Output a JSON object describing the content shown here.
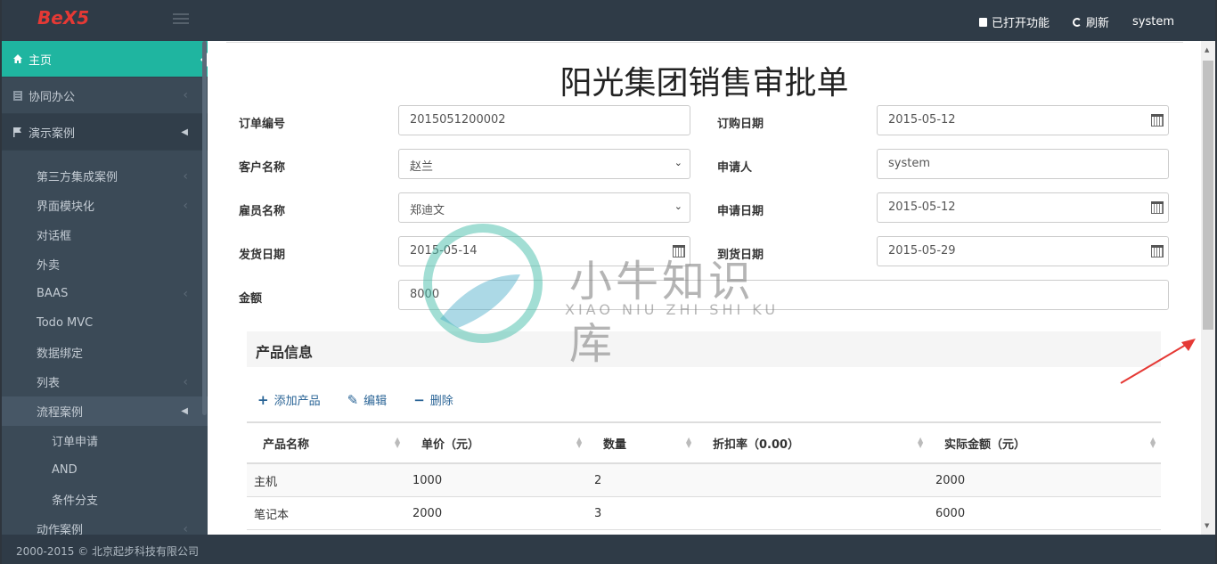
{
  "app": {
    "logo": "BeX5"
  },
  "topbar": {
    "opened_label": "已打开功能",
    "refresh_label": "刷新",
    "user": "system"
  },
  "sidebar": {
    "items": [
      {
        "label": "主页",
        "icon": "home-icon"
      },
      {
        "label": "协同办公",
        "icon": "document-icon"
      },
      {
        "label": "演示案例",
        "icon": "flag-icon"
      }
    ],
    "sub_items": [
      {
        "label": "第三方集成案例"
      },
      {
        "label": "界面模块化"
      },
      {
        "label": "对话框"
      },
      {
        "label": "外卖"
      },
      {
        "label": "BAAS"
      },
      {
        "label": "Todo MVC"
      },
      {
        "label": "数据绑定"
      },
      {
        "label": "列表"
      },
      {
        "label": "流程案例"
      },
      {
        "label": "订单申请"
      },
      {
        "label": "AND"
      },
      {
        "label": "条件分支"
      },
      {
        "label": "动作案例"
      }
    ]
  },
  "footer": {
    "text": "2000-2015 © 北京起步科技有限公司"
  },
  "form": {
    "title": "阳光集团销售审批单",
    "order_no_label": "订单编号",
    "order_no": "2015051200002",
    "order_date_label": "订购日期",
    "order_date": "2015-05-12",
    "customer_label": "客户名称",
    "customer": "赵兰",
    "applicant_label": "申请人",
    "applicant": "system",
    "employee_label": "雇员名称",
    "employee": "郑迪文",
    "apply_date_label": "申请日期",
    "apply_date": "2015-05-12",
    "ship_date_label": "发货日期",
    "ship_date": "2015-05-14",
    "arrive_date_label": "到货日期",
    "arrive_date": "2015-05-29",
    "amount_label": "金额",
    "amount": "8000"
  },
  "products": {
    "title": "产品信息",
    "add_label": "添加产品",
    "edit_label": "编辑",
    "delete_label": "删除",
    "columns": [
      "产品名称",
      "单价（元）",
      "数量",
      "折扣率（0.00）",
      "实际金额（元）"
    ],
    "rows": [
      [
        "主机",
        "1000",
        "2",
        "",
        "2000"
      ],
      [
        "笔记本",
        "2000",
        "3",
        "",
        "6000"
      ]
    ]
  },
  "watermark": {
    "text": "小牛知识库",
    "sub": "XIAO NIU ZHI SHI KU"
  }
}
